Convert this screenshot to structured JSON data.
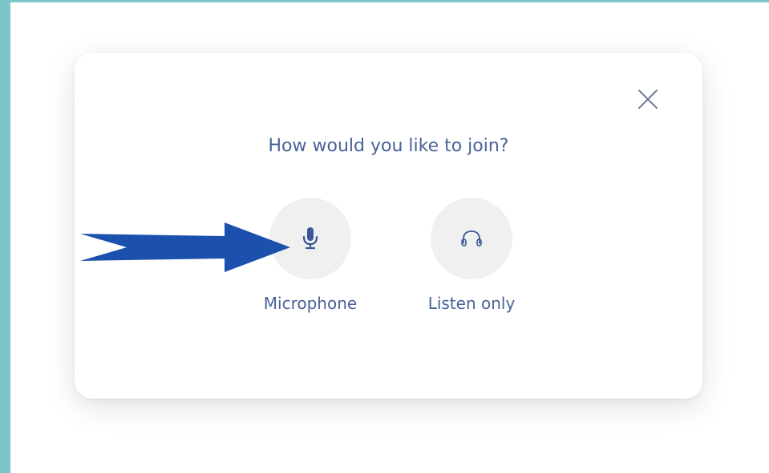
{
  "dialog": {
    "title": "How would you like to join?",
    "options": [
      {
        "label": "Microphone",
        "icon": "microphone-icon"
      },
      {
        "label": "Listen only",
        "icon": "headphones-icon"
      }
    ],
    "close_icon": "close-icon"
  },
  "annotation": {
    "icon": "arrow-right-icon",
    "color": "#1b50ad"
  },
  "colors": {
    "frame": "#7cc6c9",
    "text": "#4a6296",
    "option_circle": "#f0f0f0"
  }
}
